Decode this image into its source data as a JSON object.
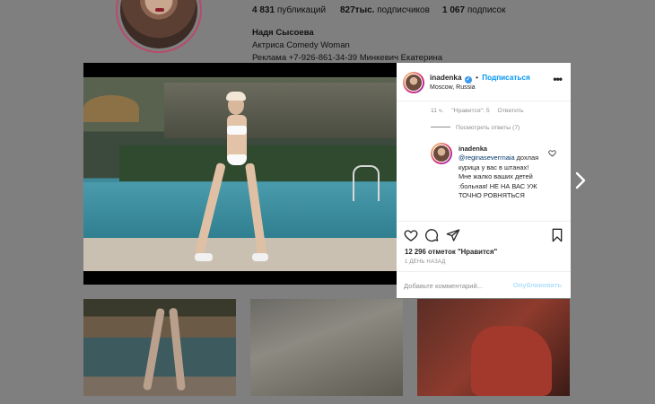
{
  "profile": {
    "stats": {
      "posts_count": "4 831",
      "posts_label": "публикаций",
      "followers_count": "827тыс.",
      "followers_label": "подписчиков",
      "following_count": "1 067",
      "following_label": "подписок"
    },
    "bio": {
      "name": "Надя Сысоева",
      "line1": "Актриса Comedy Woman",
      "line2": "Реклама +7-926-861-34-39 Минкевич Екатерина"
    }
  },
  "post": {
    "username": "inadenka",
    "separator": "•",
    "follow_label": "Подписаться",
    "location": "Moscow, Russia",
    "more_icon": "more-dots-icon",
    "comment_meta": {
      "time": "11 ч.",
      "likes": "\"Нравится\": 5",
      "reply": "Ответить"
    },
    "view_replies": "Посмотреть ответы (7)",
    "reply": {
      "username": "inadenka",
      "mention": "@reginaseverrnaia",
      "text": "дохлая курица у вас в штанах! Мне жалко ваших детей :больная! НЕ НА ВАС УЖ ТОЧНО РОВНЯТЬСЯ"
    },
    "likes_count": "12 296 отметок \"Нравится\"",
    "time_ago": "1 день назад",
    "comment_placeholder": "Добавьте комментарий...",
    "post_button": "Опубликовать"
  },
  "colors": {
    "link": "#0095f6",
    "overlay": "#7f7f7f",
    "post_disabled": "#b2dffc"
  }
}
